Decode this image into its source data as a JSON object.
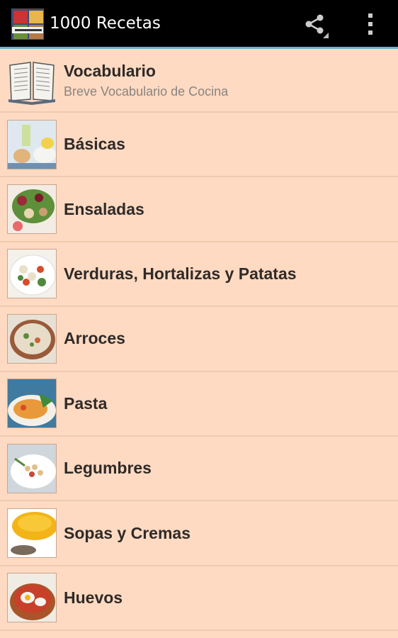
{
  "actionbar": {
    "title": "1000 Recetas",
    "app_icon": "cookbook-cover-icon",
    "share_icon": "share-icon",
    "overflow_icon": "overflow-menu-icon"
  },
  "colors": {
    "list_background": "#fedac2",
    "actionbar": "#000000",
    "accent": "#6fb3c9",
    "title_text": "#2f2a28",
    "subtitle_text": "#8a8480"
  },
  "categories": [
    {
      "title": "Vocabulario",
      "subtitle": "Breve Vocabulario de Cocina",
      "icon": "open-book-icon"
    },
    {
      "title": "Básicas",
      "subtitle": "",
      "icon": "basics-food-thumbnail"
    },
    {
      "title": "Ensaladas",
      "subtitle": "",
      "icon": "salad-thumbnail"
    },
    {
      "title": "Verduras, Hortalizas y Patatas",
      "subtitle": "",
      "icon": "vegetables-thumbnail"
    },
    {
      "title": "Arroces",
      "subtitle": "",
      "icon": "rice-thumbnail"
    },
    {
      "title": "Pasta",
      "subtitle": "",
      "icon": "pasta-thumbnail"
    },
    {
      "title": "Legumbres",
      "subtitle": "",
      "icon": "legumes-thumbnail"
    },
    {
      "title": "Sopas y Cremas",
      "subtitle": "",
      "icon": "soup-thumbnail"
    },
    {
      "title": "Huevos",
      "subtitle": "",
      "icon": "eggs-thumbnail"
    }
  ]
}
